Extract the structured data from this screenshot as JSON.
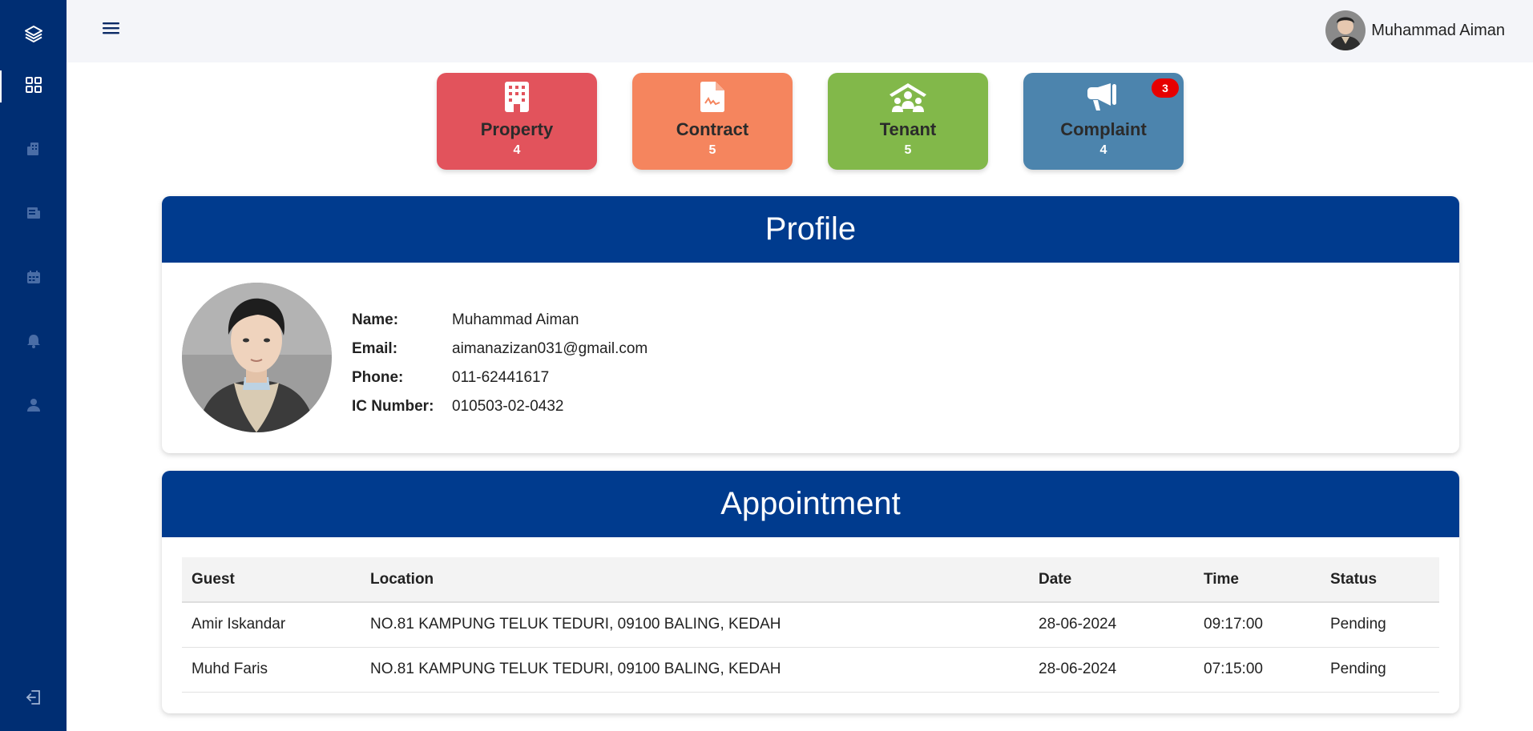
{
  "sidebar": {
    "logo_icon": "layers-icon",
    "items": [
      {
        "icon": "dashboard-grid-icon",
        "active": true
      },
      {
        "icon": "building-icon",
        "active": false
      },
      {
        "icon": "document-icon",
        "active": false
      },
      {
        "icon": "calendar-icon",
        "active": false
      },
      {
        "icon": "bell-icon",
        "active": false
      },
      {
        "icon": "user-icon",
        "active": false
      }
    ],
    "logout_icon": "logout-icon"
  },
  "topbar": {
    "menu_icon": "hamburger-icon",
    "user_name": "Muhammad Aiman"
  },
  "stats": [
    {
      "label": "Property",
      "count": "4",
      "color": "#e2535c",
      "icon": "building-icon"
    },
    {
      "label": "Contract",
      "count": "5",
      "color": "#f5855e",
      "icon": "contract-icon"
    },
    {
      "label": "Tenant",
      "count": "5",
      "color": "#82b84a",
      "icon": "tenant-group-icon"
    },
    {
      "label": "Complaint",
      "count": "4",
      "color": "#4c84ad",
      "icon": "megaphone-icon",
      "badge": "3"
    }
  ],
  "profile": {
    "title": "Profile",
    "fields": [
      {
        "label": "Name:",
        "value": "Muhammad Aiman"
      },
      {
        "label": "Email:",
        "value": "aimanazizan031@gmail.com"
      },
      {
        "label": "Phone:",
        "value": "011-62441617"
      },
      {
        "label": "IC Number:",
        "value": "010503-02-0432"
      }
    ]
  },
  "appointment": {
    "title": "Appointment",
    "columns": [
      "Guest",
      "Location",
      "Date",
      "Time",
      "Status"
    ],
    "rows": [
      [
        "Amir Iskandar",
        "NO.81 KAMPUNG TELUK TEDURI, 09100 BALING, KEDAH",
        "28-06-2024",
        "09:17:00",
        "Pending"
      ],
      [
        "Muhd Faris",
        "NO.81 KAMPUNG TELUK TEDURI, 09100 BALING, KEDAH",
        "28-06-2024",
        "07:15:00",
        "Pending"
      ]
    ]
  }
}
